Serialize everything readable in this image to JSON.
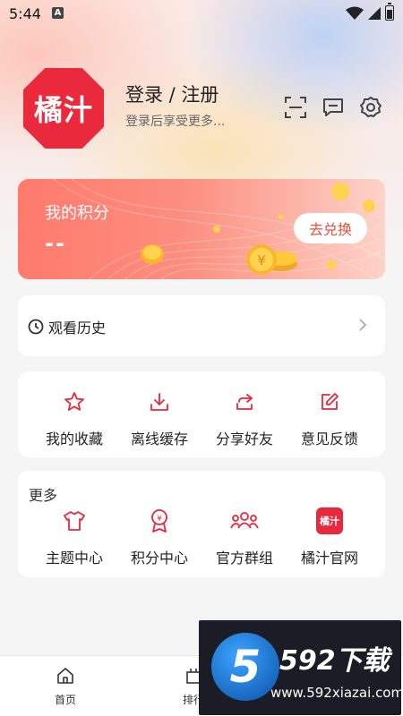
{
  "status_bar": {
    "time": "5:44",
    "notification_badge": "A"
  },
  "profile": {
    "avatar_text": "橘汁",
    "title": "登录 / 注册",
    "subtitle": "登录后享受更多..."
  },
  "header_icons": [
    "scan-icon",
    "message-icon",
    "settings-icon"
  ],
  "points": {
    "label": "我的积分",
    "value": "--",
    "redeem_label": "去兑换"
  },
  "history": {
    "label": "观看历史"
  },
  "actions": [
    {
      "label": "我的收藏",
      "icon": "star-icon"
    },
    {
      "label": "离线缓存",
      "icon": "download-icon"
    },
    {
      "label": "分享好友",
      "icon": "share-icon"
    },
    {
      "label": "意见反馈",
      "icon": "feedback-icon"
    }
  ],
  "more": {
    "title": "更多",
    "items": [
      {
        "label": "主题中心",
        "icon": "tshirt-icon"
      },
      {
        "label": "积分中心",
        "icon": "medal-icon"
      },
      {
        "label": "官方群组",
        "icon": "group-icon"
      },
      {
        "label": "橘汁官网",
        "icon": "logo-icon",
        "icon_text": "橘汁"
      }
    ]
  },
  "bottom_nav": [
    {
      "label": "首页",
      "icon": "home-icon"
    },
    {
      "label": "排行",
      "icon": "ranking-icon"
    }
  ],
  "watermark": {
    "badge": "5",
    "brand": "592下载",
    "url": "www.592xiazai.com"
  },
  "colors": {
    "accent": "#e8283c",
    "points_gradient_start": "#fe7a6d",
    "points_gradient_end": "#fdd3c8"
  }
}
